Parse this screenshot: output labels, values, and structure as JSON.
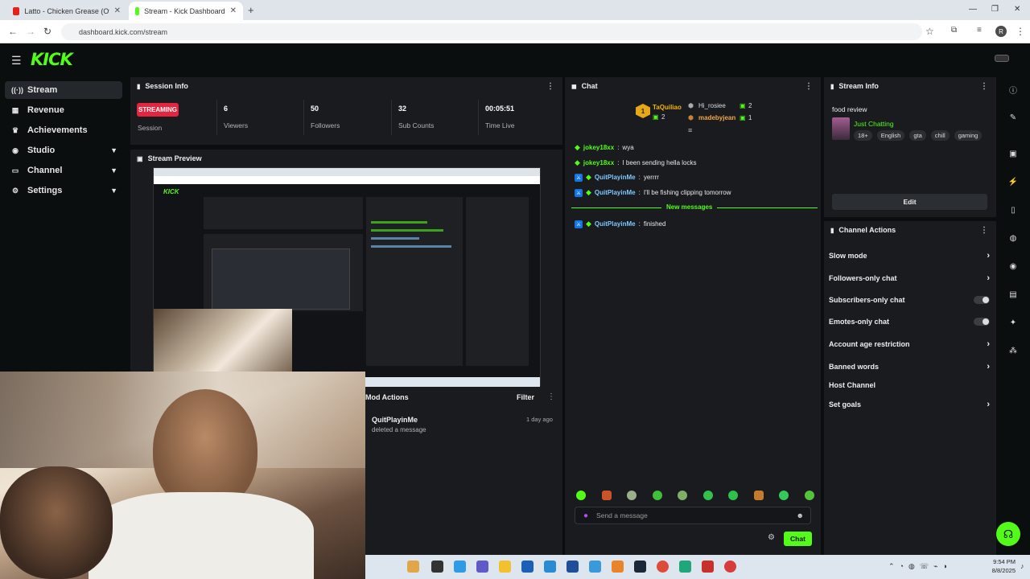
{
  "browser": {
    "tabs": [
      {
        "title": "Latto - Chicken Grease (Official",
        "active": false
      },
      {
        "title": "Stream - Kick Dashboard",
        "active": true
      }
    ],
    "new_tab": "+",
    "url": "dashboard.kick.com/stream"
  },
  "header": {
    "logo": "KICK"
  },
  "sidebar": {
    "items": [
      {
        "label": "Stream",
        "icon": "broadcast-icon",
        "active": true
      },
      {
        "label": "Revenue",
        "icon": "revenue-icon"
      },
      {
        "label": "Achievements",
        "icon": "trophy-icon"
      },
      {
        "label": "Studio",
        "icon": "studio-icon",
        "expandable": true
      },
      {
        "label": "Channel",
        "icon": "channel-icon",
        "expandable": true
      },
      {
        "label": "Settings",
        "icon": "gear-icon",
        "expandable": true
      }
    ]
  },
  "session_info": {
    "title": "Session Info",
    "status_badge": "STREAMING",
    "status_label": "Session",
    "stats": [
      {
        "value": "6",
        "label": "Viewers"
      },
      {
        "value": "50",
        "label": "Followers"
      },
      {
        "value": "32",
        "label": "Sub Counts"
      },
      {
        "value": "00:05:51",
        "label": "Time Live"
      }
    ]
  },
  "stream_preview": {
    "title": "Stream Preview"
  },
  "mod_actions": {
    "title": "Mod Actions",
    "filter_label": "Filter",
    "entries": [
      {
        "user": "QuitPlayinMe",
        "action": "deleted a message",
        "time": "1 day ago"
      }
    ]
  },
  "chat": {
    "title": "Chat",
    "leaderboard": {
      "first": {
        "rank": "1",
        "name": "TaQuiliao",
        "count": "2"
      },
      "others": [
        {
          "name": "Hi_rosiee",
          "count": "2"
        },
        {
          "name": "madebyjean",
          "count": "1"
        }
      ]
    },
    "messages": [
      {
        "user": "jokey18xx",
        "text": "wya",
        "mod": false,
        "color": "#53fc18"
      },
      {
        "user": "jokey18xx",
        "text": "I been sending hella locks",
        "mod": false,
        "color": "#53fc18"
      },
      {
        "user": "QuitPlayinMe",
        "text": "yerrrr",
        "mod": true,
        "color": "#7ec8ff"
      },
      {
        "user": "QuitPlayinMe",
        "text": "I'll be fishing clipping tomorrow",
        "mod": true,
        "color": "#7ec8ff"
      }
    ],
    "new_messages_divider": "New messages",
    "after_divider": [
      {
        "user": "QuitPlayinMe",
        "text": "finished",
        "mod": true,
        "color": "#7ec8ff"
      }
    ],
    "input_placeholder": "Send a message",
    "send_label": "Chat"
  },
  "stream_info": {
    "title": "Stream Info",
    "stream_title": "food review",
    "category": "Just Chatting",
    "tags": [
      "18+",
      "English",
      "gta",
      "chill",
      "gaming"
    ],
    "edit_label": "Edit"
  },
  "channel_actions": {
    "title": "Channel Actions",
    "items": [
      {
        "label": "Slow mode",
        "control": "chevron"
      },
      {
        "label": "Followers-only chat",
        "control": "chevron"
      },
      {
        "label": "Subscribers-only chat",
        "control": "toggle"
      },
      {
        "label": "Emotes-only chat",
        "control": "toggle"
      },
      {
        "label": "Account age restriction",
        "control": "chevron"
      },
      {
        "label": "Banned words",
        "control": "chevron"
      },
      {
        "label": "Host Channel",
        "control": "none"
      },
      {
        "label": "Set goals",
        "control": "chevron"
      }
    ]
  },
  "system_tray": {
    "time": "9:54 PM",
    "date": "8/8/2025"
  },
  "colors": {
    "kick_green": "#53fc18",
    "streaming_red": "#e5253f",
    "panel_bg": "#191b1f",
    "page_bg": "#0b0e0f"
  }
}
